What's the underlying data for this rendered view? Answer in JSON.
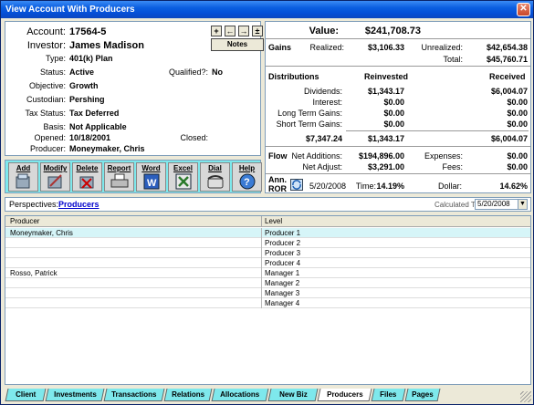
{
  "window": {
    "title": "View Account With Producers",
    "close": "✕"
  },
  "account": {
    "account_label": "Account:",
    "account_value": "17564-5",
    "investor_label": "Investor:",
    "investor_value": "James Madison",
    "type_label": "Type:",
    "type_value": "401(k) Plan",
    "status_label": "Status:",
    "status_value": "Active",
    "qualified_label": "Qualified?:",
    "qualified_value": "No",
    "objective_label": "Objective:",
    "objective_value": "Growth",
    "custodian_label": "Custodian:",
    "custodian_value": "Pershing",
    "taxstatus_label": "Tax Status:",
    "taxstatus_value": "Tax Deferred",
    "basis_label": "Basis:",
    "basis_value": "Not Applicable",
    "opened_label": "Opened:",
    "opened_value": "10/18/2001",
    "closed_label": "Closed:",
    "closed_value": "",
    "producer_label": "Producer:",
    "producer_value": "Moneymaker, Chris",
    "notes_label": "Notes",
    "nav": [
      "+",
      "←",
      "→",
      "±"
    ]
  },
  "toolbar": {
    "buttons": [
      {
        "label": "Add",
        "icon": "add-icon"
      },
      {
        "label": "Modify",
        "icon": "modify-icon"
      },
      {
        "label": "Delete",
        "icon": "delete-icon"
      },
      {
        "label": "Report",
        "icon": "printer-icon"
      },
      {
        "label": "Word",
        "icon": "word-icon"
      },
      {
        "label": "Excel",
        "icon": "excel-icon"
      },
      {
        "label": "Dial",
        "icon": "phone-icon"
      },
      {
        "label": "Help",
        "icon": "help-icon"
      }
    ]
  },
  "summary": {
    "value_label": "Value:",
    "value": "$241,708.73",
    "gains_label": "Gains",
    "realized_label": "Realized:",
    "realized": "$3,106.33",
    "unrealized_label": "Unrealized:",
    "unrealized": "$42,654.38",
    "total_label": "Total:",
    "total": "$45,760.71",
    "distributions_label": "Distributions",
    "reinvested_label": "Reinvested",
    "received_label": "Received",
    "dividends_label": "Dividends:",
    "dividends_reinvested": "$1,343.17",
    "dividends_received": "$6,004.07",
    "interest_label": "Interest:",
    "interest_reinvested": "$0.00",
    "interest_received": "$0.00",
    "ltg_label": "Long Term Gains:",
    "ltg_reinvested": "$0.00",
    "ltg_received": "$0.00",
    "stg_label": "Short Term Gains:",
    "stg_reinvested": "$0.00",
    "stg_received": "$0.00",
    "dist_total": "$7,347.24",
    "dist_reinvested_total": "$1,343.17",
    "dist_received_total": "$6,004.07",
    "flow_label": "Flow",
    "net_additions_label": "Net Additions:",
    "net_additions": "$194,896.00",
    "expenses_label": "Expenses:",
    "expenses": "$0.00",
    "net_adjust_label": "Net Adjust:",
    "net_adjust": "$3,291.00",
    "fees_label": "Fees:",
    "fees": "$0.00",
    "ann_label": "Ann.",
    "ror_label": "ROR",
    "ror_date": "5/20/2008",
    "time_label": "Time:",
    "time_value": "14.19%",
    "dollar_label": "Dollar:",
    "dollar_value": "14.62%"
  },
  "perspectives": {
    "label": "Perspectives:",
    "link": "Producers",
    "calc_label": "Calculated To",
    "calc_date": "5/20/2008"
  },
  "grid": {
    "col_producer": "Producer",
    "col_level": "Level",
    "rows": [
      {
        "producer": "Moneymaker, Chris",
        "level": "Producer 1",
        "highlight": true
      },
      {
        "producer": "",
        "level": "Producer 2"
      },
      {
        "producer": "",
        "level": "Producer 3"
      },
      {
        "producer": "",
        "level": "Producer 4"
      },
      {
        "producer": "Rosso, Patrick",
        "level": "Manager 1"
      },
      {
        "producer": "",
        "level": "Manager 2"
      },
      {
        "producer": "",
        "level": "Manager 3"
      },
      {
        "producer": "",
        "level": "Manager 4"
      }
    ]
  },
  "tabs": [
    "Client",
    "Investments",
    "Transactions",
    "Relations",
    "Allocations",
    "New Biz",
    "Producers",
    "Files",
    "Pages"
  ],
  "active_tab": "Producers",
  "colors": {
    "accent": "#7ee8ec",
    "title_blue": "#0a5ee0",
    "highlight_row": "#d6f5f8",
    "link": "#0000cc"
  }
}
